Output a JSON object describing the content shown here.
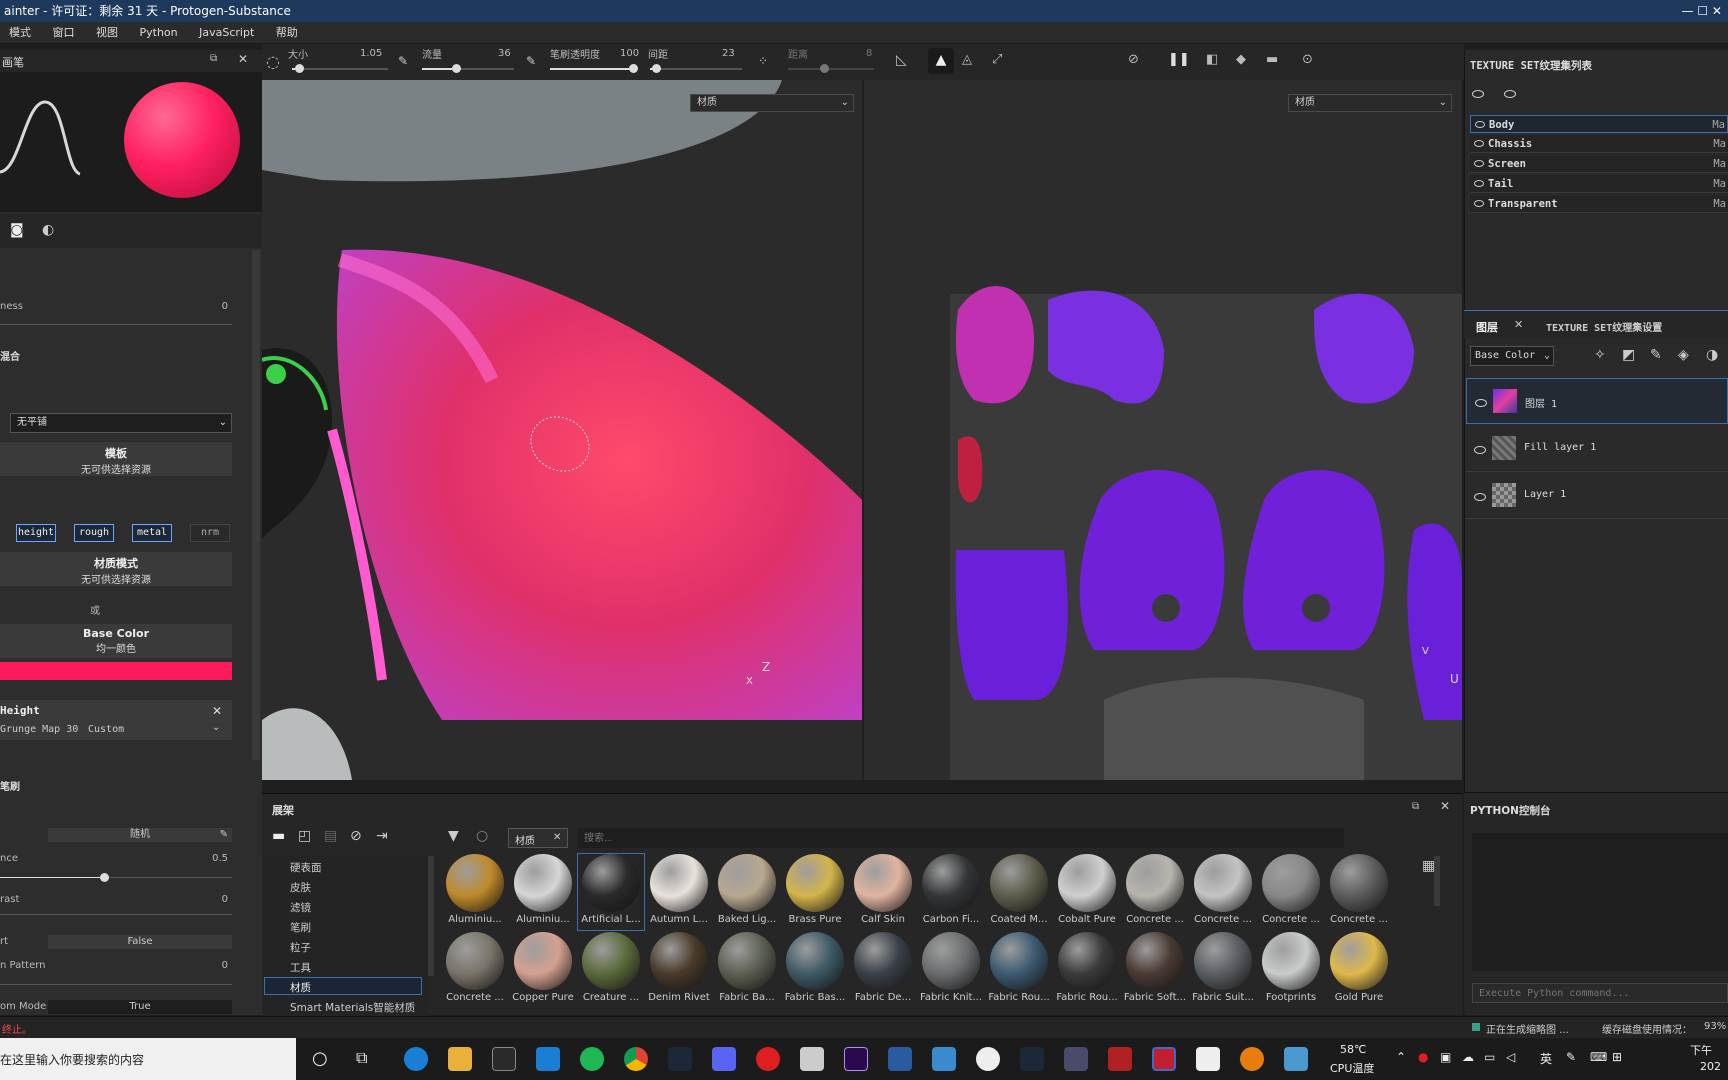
{
  "window": {
    "title": "ainter - 许可证：剩余 31 天 - Protogen-Substance",
    "controls": "—   ☐   ✕"
  },
  "menu": [
    "模式",
    "窗口",
    "视图",
    "Python",
    "JavaScript",
    "帮助"
  ],
  "toolbar": {
    "size_label": "大小",
    "size_value": "1.05",
    "size_fraction": 0.03,
    "flow_label": "流量",
    "flow_value": "36",
    "flow_fraction": 0.36,
    "opacity_label": "笔刷透明度",
    "opacity_value": "100",
    "opacity_fraction": 1.0,
    "spacing_label": "间距",
    "spacing_value": "23",
    "spacing_fraction": 0.02,
    "jitter_label": "距离",
    "jitter_value": "8"
  },
  "left": {
    "panel_title": "画笔",
    "hardness_label": "ness",
    "hardness_value": "0",
    "blend_header": "混合",
    "tiling_select": "无平铺",
    "stencil_title": "模板",
    "stencil_sub": "无可供选择资源",
    "channels": [
      "height",
      "rough",
      "metal",
      "nrm"
    ],
    "material_title": "材质模式",
    "material_sub": "无可供选择资源",
    "or_label": "或",
    "basecolor_title": "Base Color",
    "basecolor_sub": "均一颜色",
    "basecolor_color": "#ff1a5c",
    "height_title": "Height",
    "height_map": "Grunge Map 30",
    "height_mode": "Custom",
    "brush_header": "笔刷",
    "random_label": "随机",
    "balance_label": "nce",
    "balance_value": "0.5",
    "balance_fraction": 0.45,
    "contrast_label": "rast",
    "contrast_value": "0",
    "invert_label": "rt",
    "invert_value": "False",
    "pattern_label": "n Pattern",
    "pattern_value": "0",
    "mode_label": "om Mode",
    "mode_value": "True"
  },
  "viewport": {
    "left_select": "材质",
    "right_select": "材质",
    "axis_left": "Z",
    "axis_left2": "X",
    "axis_right": "U",
    "axis_right2": "V"
  },
  "texture_sets": {
    "title": "TEXTURE SET纹理集列表",
    "rows": [
      {
        "name": "Body",
        "tag": "Ma"
      },
      {
        "name": "Chassis",
        "tag": "Ma"
      },
      {
        "name": "Screen",
        "tag": "Ma"
      },
      {
        "name": "Tail",
        "tag": "Ma"
      },
      {
        "name": "Transparent",
        "tag": "Ma"
      }
    ]
  },
  "layers": {
    "tab1": "图层",
    "tab2": "TEXTURE SET纹理集设置",
    "channel_select": "Base Color",
    "items": [
      {
        "name": "图层 1"
      },
      {
        "name": "Fill layer 1"
      },
      {
        "name": "Layer 1"
      }
    ]
  },
  "python": {
    "title": "PYTHON控制台",
    "placeholder": "Execute Python command..."
  },
  "shelf": {
    "title": "展架",
    "tab_label": "材质",
    "search_placeholder": "搜索...",
    "categories": [
      "硬表面",
      "皮肤",
      "滤镜",
      "笔刷",
      "粒子",
      "工具",
      "材质",
      "Smart Materials智能材质"
    ],
    "selected_category": "材质",
    "materials_row1": [
      {
        "name": "Aluminiu...",
        "color": "#c08a2a"
      },
      {
        "name": "Aluminiu...",
        "color": "#d6d6d6"
      },
      {
        "name": "Artificial L...",
        "color": "#2a2a2a"
      },
      {
        "name": "Autumn L...",
        "color": "#e9e2dc"
      },
      {
        "name": "Baked Lig...",
        "color": "#b8a890"
      },
      {
        "name": "Brass Pure",
        "color": "#d4b44a"
      },
      {
        "name": "Calf Skin",
        "color": "#e0b4a0"
      },
      {
        "name": "Carbon Fi...",
        "color": "#333638"
      },
      {
        "name": "Coated M...",
        "color": "#5e5c4a"
      },
      {
        "name": "Cobalt Pure",
        "color": "#cfcfcf"
      },
      {
        "name": "Concrete ...",
        "color": "#b8b4ae"
      },
      {
        "name": "Concrete ...",
        "color": "#c4c4c4"
      },
      {
        "name": "Concrete ...",
        "color": "#888888"
      },
      {
        "name": "Concrete ...",
        "color": "#5c5c5c"
      }
    ],
    "materials_row2": [
      {
        "name": "Concrete ...",
        "color": "#7a7468"
      },
      {
        "name": "Copper Pure",
        "color": "#d4a090"
      },
      {
        "name": "Creature ...",
        "color": "#5a6a3a"
      },
      {
        "name": "Denim Rivet",
        "color": "#4a3a2a"
      },
      {
        "name": "Fabric Ba...",
        "color": "#5c6050"
      },
      {
        "name": "Fabric Bas...",
        "color": "#3e5a66"
      },
      {
        "name": "Fabric De...",
        "color": "#3a4048"
      },
      {
        "name": "Fabric Knit...",
        "color": "#6a6c6e"
      },
      {
        "name": "Fabric Rou...",
        "color": "#3c5a72"
      },
      {
        "name": "Fabric Rou...",
        "color": "#3a3a3a"
      },
      {
        "name": "Fabric Soft...",
        "color": "#4a3a34"
      },
      {
        "name": "Fabric Suit...",
        "color": "#5a5e62"
      },
      {
        "name": "Footprints",
        "color": "#c8ccca"
      },
      {
        "name": "Gold Pure",
        "color": "#e0b84a"
      }
    ]
  },
  "status": {
    "left": "终止。",
    "mid": "正在生成缩略图 ...",
    "disk": "缓存磁盘使用情况：",
    "disk_value": "93%"
  },
  "taskbar": {
    "search": "在这里输入你要搜索的内容",
    "temp": "58℃",
    "temp_label": "CPU温度",
    "lang": "英",
    "time": "下午",
    "date": "202"
  }
}
